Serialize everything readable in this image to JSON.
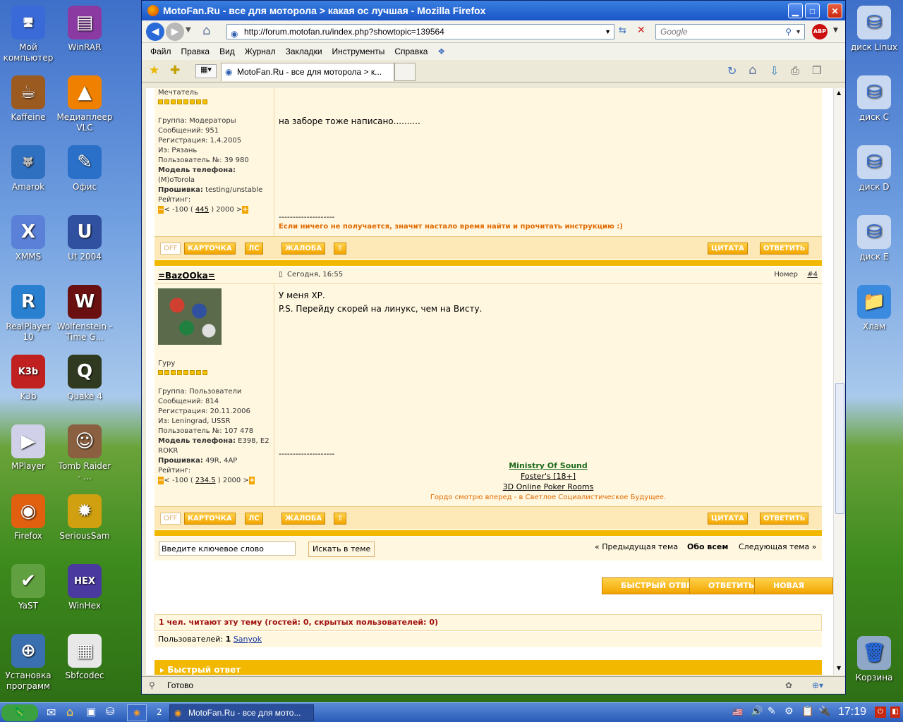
{
  "desktop_left": [
    {
      "label": "Мой компьютер",
      "icon": "computer-icon"
    },
    {
      "label": "WinRAR",
      "icon": "winrar-icon"
    },
    {
      "label": "Kaffeine",
      "icon": "kaffeine-icon"
    },
    {
      "label": "Медиаплеер VLC",
      "icon": "vlc-icon"
    },
    {
      "label": "Amarok",
      "icon": "amarok-icon"
    },
    {
      "label": "Офис",
      "icon": "office-icon"
    },
    {
      "label": "XMMS",
      "icon": "xmms-icon"
    },
    {
      "label": "Ut 2004",
      "icon": "ut2004-icon"
    },
    {
      "label": "RealPlayer 10",
      "icon": "realplayer-icon"
    },
    {
      "label": "Wolfenstein - Time G...",
      "icon": "wolfenstein-icon"
    },
    {
      "label": "K3b",
      "icon": "k3b-icon"
    },
    {
      "label": "Quake 4",
      "icon": "quake-icon"
    },
    {
      "label": "MPlayer",
      "icon": "mplayer-icon"
    },
    {
      "label": "Tomb Raider - ...",
      "icon": "tombraider-icon"
    },
    {
      "label": "Firefox",
      "icon": "firefox-icon"
    },
    {
      "label": "SeriousSam",
      "icon": "serioussam-icon"
    },
    {
      "label": "YaST",
      "icon": "yast-icon"
    },
    {
      "label": "WinHex",
      "icon": "winhex-icon"
    },
    {
      "label": "Установка программ",
      "icon": "install-icon"
    },
    {
      "label": "Sbfcodec",
      "icon": "sbfcodec-icon"
    }
  ],
  "desktop_right": [
    {
      "label": "диск Linux",
      "icon": "drive-icon"
    },
    {
      "label": "диск C",
      "icon": "drive-icon"
    },
    {
      "label": "диск D",
      "icon": "drive-icon"
    },
    {
      "label": "диск E",
      "icon": "drive-icon"
    },
    {
      "label": "Хлам",
      "icon": "folder-icon"
    },
    {
      "label": "Корзина",
      "icon": "trash-icon"
    }
  ],
  "browser": {
    "title": "MotoFan.Ru - все для моторола > какая ос лучшая - Mozilla Firefox",
    "url": "http://forum.motofan.ru/index.php?showtopic=139564",
    "search_placeholder": "Google",
    "menu": [
      "Файл",
      "Правка",
      "Вид",
      "Журнал",
      "Закладки",
      "Инструменты",
      "Справка"
    ],
    "tab_title": "MotoFan.Ru - все для моторола > к...",
    "status": "Готово"
  },
  "post1": {
    "rank": "Мечтатель",
    "group": "Группа: Модераторы",
    "messages": "Сообщений: 951",
    "registered": "Регистрация: 1.4.2005",
    "from": "Из: Рязань",
    "user_no": "Пользователь №: 39 980",
    "phone_label": "Модель телефона:",
    "phone": "(M)oTorola",
    "firmware_label": "Прошивка:",
    "firmware": "testing/unstable",
    "rating_label": "Рейтинг:",
    "rating_pre": "< -100 (",
    "rating_val": "445",
    "rating_post": ") 2000 >",
    "text": "на заборе тоже написано..........",
    "divider": "--------------------",
    "signature": "Если ничего не получается, значит настало время найти и прочитать инструкцию :)"
  },
  "post2": {
    "author": "=BazOOka=",
    "date": "Сегодня, 16:55",
    "number_label": "Номер",
    "number": "#4",
    "rank": "Гуру",
    "group": "Группа: Пользователи",
    "messages": "Сообщений: 814",
    "registered": "Регистрация: 20.11.2006",
    "from": "Из: Leningrad, USSR",
    "user_no": "Пользователь №: 107 478",
    "phone_label": "Модель телефона:",
    "phone": "E398, E2 ROKR",
    "firmware_label": "Прошивка:",
    "firmware": "49R, 4AP",
    "rating_label": "Рейтинг:",
    "rating_pre": "< -100 (",
    "rating_val": "234.5",
    "rating_post": ") 2000 >",
    "text1": "У меня ХР.",
    "text2": "P.S. Перейду скорей на линукс, чем на Висту.",
    "divider": "--------------------",
    "sig1": "Ministry Of Sound",
    "sig2": "Foster's [18+]",
    "sig3": "3D Online Poker Rooms",
    "sig4": "Гордо смотрю вперед - в Светлое Социалистическое Будущее."
  },
  "buttons": {
    "off": "OFF",
    "card": "КАРТОЧКА",
    "pm": "ЛС",
    "complaint": "ЖАЛОБА",
    "quote": "ЦИТАТА",
    "reply": "ОТВЕТИТЬ"
  },
  "topic_search": {
    "placeholder": "Введите ключевое слово",
    "button": "Искать в теме"
  },
  "topic_nav": {
    "prev": "« Предыдущая тема",
    "about": "Обо всем",
    "next": "Следующая тема »"
  },
  "big_buttons": {
    "fast_reply": "БЫСТРЫЙ ОТВЕТ",
    "reply": "ОТВЕТИТЬ",
    "new_topic": "НОВАЯ ТЕМА"
  },
  "readers": {
    "title": "1 чел. читают эту тему (гостей: 0, скрытых пользователей: 0)",
    "users_label": "Пользователей:",
    "users_count": "1",
    "user": "Sanyok"
  },
  "fast_reply_header": "Быстрый ответ",
  "taskbar": {
    "desktop_no": "2",
    "task": "MotoFan.Ru - все для мото...",
    "clock": "17:19"
  }
}
